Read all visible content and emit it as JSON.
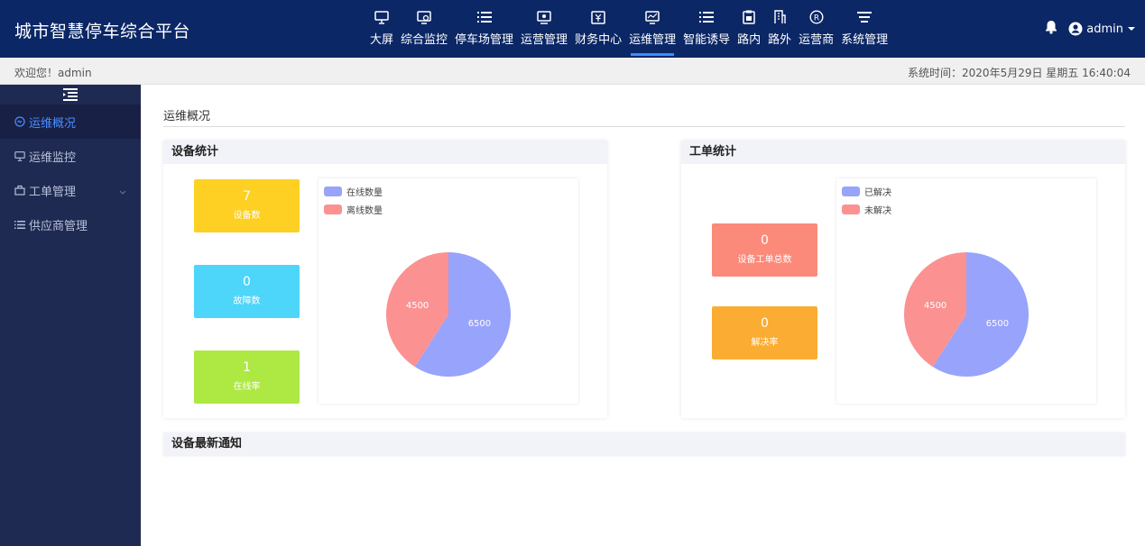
{
  "app": {
    "title": "城市智慧停车综合平台"
  },
  "nav": [
    {
      "label": "大屏",
      "icon": "monitor-icon"
    },
    {
      "label": "综合监控",
      "icon": "camera-monitor-icon"
    },
    {
      "label": "停车场管理",
      "icon": "list-icon"
    },
    {
      "label": "运营管理",
      "icon": "screen-dot-icon"
    },
    {
      "label": "财务中心",
      "icon": "finance-icon"
    },
    {
      "label": "运维管理",
      "icon": "chart-monitor-icon",
      "active": true
    },
    {
      "label": "智能诱导",
      "icon": "list-icon"
    },
    {
      "label": "路内",
      "icon": "clipboard-icon"
    },
    {
      "label": "路外",
      "icon": "building-icon"
    },
    {
      "label": "运营商",
      "icon": "badge-icon"
    },
    {
      "label": "系统管理",
      "icon": "menu-icon"
    }
  ],
  "user": {
    "name": "admin"
  },
  "welcome": {
    "text": "欢迎您！admin",
    "time_label": "系统时间：",
    "time": "2020年5月29日 星期五 16:40:04"
  },
  "sidebar": {
    "items": [
      {
        "label": "运维概况",
        "icon": "overview-icon",
        "active": true
      },
      {
        "label": "运维监控",
        "icon": "monitor-icon"
      },
      {
        "label": "工单管理",
        "icon": "workorder-icon",
        "has_children": true
      },
      {
        "label": "供应商管理",
        "icon": "list-icon"
      }
    ]
  },
  "breadcrumb": "运维概况",
  "device_panel": {
    "title": "设备统计",
    "tiles": [
      {
        "value": "7",
        "label": "设备数",
        "color": "#fdd023"
      },
      {
        "value": "0",
        "label": "故障数",
        "color": "#4dd5fa"
      },
      {
        "value": "1",
        "label": "在线率",
        "color": "#aee843"
      }
    ]
  },
  "workorder_panel": {
    "title": "工单统计",
    "tiles": [
      {
        "value": "0",
        "label": "设备工单总数",
        "color": "#fb8a7a"
      },
      {
        "value": "0",
        "label": "解决率",
        "color": "#fbac33"
      }
    ]
  },
  "notice_panel": {
    "title": "设备最新通知"
  },
  "chart_data": [
    {
      "type": "pie",
      "series": [
        {
          "name": "在线数量",
          "value": 6500,
          "color": "#98a3fb"
        },
        {
          "name": "离线数量",
          "value": 4500,
          "color": "#fb9191"
        }
      ],
      "legend": "top-left"
    },
    {
      "type": "pie",
      "series": [
        {
          "name": "已解决",
          "value": 6500,
          "color": "#98a3fb"
        },
        {
          "name": "未解决",
          "value": 4500,
          "color": "#fb9191"
        }
      ],
      "legend": "top-left"
    }
  ]
}
